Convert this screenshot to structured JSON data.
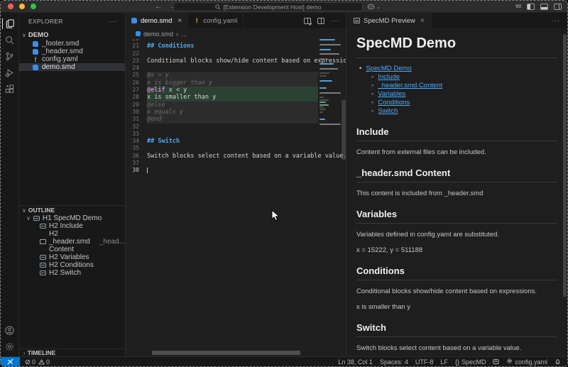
{
  "titlebar": {
    "search_text": "[Extension Development Host] demo",
    "back_icon": "←",
    "forward_icon": "→"
  },
  "activity_bar": {
    "items": [
      "explorer",
      "search",
      "source-control",
      "run-and-debug",
      "extensions"
    ],
    "bottom_items": [
      "accounts",
      "settings"
    ]
  },
  "sidebar": {
    "explorer_label": "EXPLORER",
    "more_actions": "···",
    "folder": {
      "label": "DEMO"
    },
    "files": [
      {
        "label": "_footer.smd",
        "icon": "smd",
        "selected": false
      },
      {
        "label": "_header.smd",
        "icon": "smd",
        "selected": false
      },
      {
        "label": "config.yaml",
        "icon": "yaml",
        "selected": false
      },
      {
        "label": "demo.smd",
        "icon": "smd",
        "selected": true
      }
    ],
    "outline": {
      "label": "OUTLINE",
      "items": [
        {
          "label": "H1 SpecMD Demo",
          "level": 1,
          "icon": "symbol"
        },
        {
          "label": "H2 Include",
          "level": 2,
          "icon": "symbol"
        },
        {
          "label": "H2 _header.smd Content",
          "detail": "_head...",
          "level": 2,
          "icon": "file"
        },
        {
          "label": "H2 Variables",
          "level": 2,
          "icon": "symbol"
        },
        {
          "label": "H2 Conditions",
          "level": 2,
          "icon": "symbol"
        },
        {
          "label": "H2 Switch",
          "level": 2,
          "icon": "symbol"
        }
      ]
    },
    "timeline": {
      "label": "TIMELINE"
    }
  },
  "editor": {
    "tabs": [
      {
        "label": "demo.smd",
        "icon": "smd",
        "active": true,
        "close": "×"
      },
      {
        "label": "config.yaml",
        "icon": "yaml",
        "active": false
      }
    ],
    "more_actions": "···",
    "breadcrumb": {
      "file": "demo.smd",
      "separator": "›",
      "more": "…"
    },
    "lines": [
      {
        "num": "20",
        "segs": []
      },
      {
        "num": "21",
        "segs": [
          {
            "t": "## Conditions",
            "c": "heading"
          }
        ]
      },
      {
        "num": "22",
        "segs": []
      },
      {
        "num": "23",
        "segs": [
          {
            "t": "Conditional blocks show/hide content based on expressions.",
            "c": "text"
          }
        ]
      },
      {
        "num": "24",
        "segs": []
      },
      {
        "num": "25",
        "bg": "dim",
        "segs": [
          {
            "t": "@x > y",
            "c": "inactive"
          }
        ]
      },
      {
        "num": "26",
        "bg": "dim",
        "segs": [
          {
            "t": "x is bigger than y",
            "c": "inactive"
          }
        ]
      },
      {
        "num": "27",
        "bg": "add",
        "segs": [
          {
            "t": "@elif",
            "c": "keyword"
          },
          {
            "t": " x < y",
            "c": "text"
          }
        ]
      },
      {
        "num": "28",
        "bg": "add",
        "segs": [
          {
            "t": "x is smaller than y",
            "c": "text"
          }
        ]
      },
      {
        "num": "29",
        "bg": "dim",
        "segs": [
          {
            "t": "@else",
            "c": "inactive"
          }
        ]
      },
      {
        "num": "30",
        "bg": "dim",
        "segs": [
          {
            "t": "x equals y",
            "c": "inactive"
          }
        ]
      },
      {
        "num": "31",
        "bg": "dim",
        "segs": [
          {
            "t": "@end",
            "c": "inactive"
          }
        ]
      },
      {
        "num": "32",
        "segs": []
      },
      {
        "num": "33",
        "segs": []
      },
      {
        "num": "34",
        "segs": [
          {
            "t": "## Switch",
            "c": "heading"
          }
        ]
      },
      {
        "num": "35",
        "segs": []
      },
      {
        "num": "36",
        "segs": [
          {
            "t": "Switch blocks select content based on a variable value.",
            "c": "text"
          }
        ]
      },
      {
        "num": "37",
        "segs": []
      },
      {
        "num": "38",
        "segs": [],
        "current": true
      }
    ]
  },
  "preview": {
    "tab_label": "SpecMD Preview",
    "close": "×",
    "more_actions": "···",
    "title": "SpecMD Demo",
    "toc": {
      "root": "SpecMD Demo",
      "children": [
        "Include",
        "_header.smd Content",
        "Variables",
        "Conditions",
        "Switch"
      ]
    },
    "sections": [
      {
        "heading": "Include",
        "paras": [
          "Content from external files can be included."
        ]
      },
      {
        "heading": "_header.smd Content",
        "paras": [
          "This content is included from _header.smd"
        ]
      },
      {
        "heading": "Variables",
        "paras": [
          "Variables defined in config.yaml are substituted.",
          "x = 15222, y = 511188"
        ]
      },
      {
        "heading": "Conditions",
        "paras": [
          "Conditional blocks show/hide content based on expressions.",
          "x is smaller than y"
        ]
      },
      {
        "heading": "Switch",
        "paras": [
          "Switch blocks select content based on a variable value."
        ]
      }
    ]
  },
  "statusbar": {
    "errors": "0",
    "warnings": "0",
    "line_col": "Ln 38, Col 1",
    "spaces": "Spaces: 4",
    "encoding": "UTF-8",
    "eol": "LF",
    "language_icon": "{}",
    "language": "SpecMD",
    "config": "config.yaml"
  },
  "colors": {
    "accent_blue": "#0078d4",
    "link": "#4daafc",
    "code_heading": "#4fa9f5",
    "code_keyword": "#c586c0",
    "added_line_bg": "#2b4232",
    "inactive_line_bg": "#2c2c2c",
    "smd_icon": "#3b8eea",
    "yaml_icon": "#e8c64e"
  }
}
